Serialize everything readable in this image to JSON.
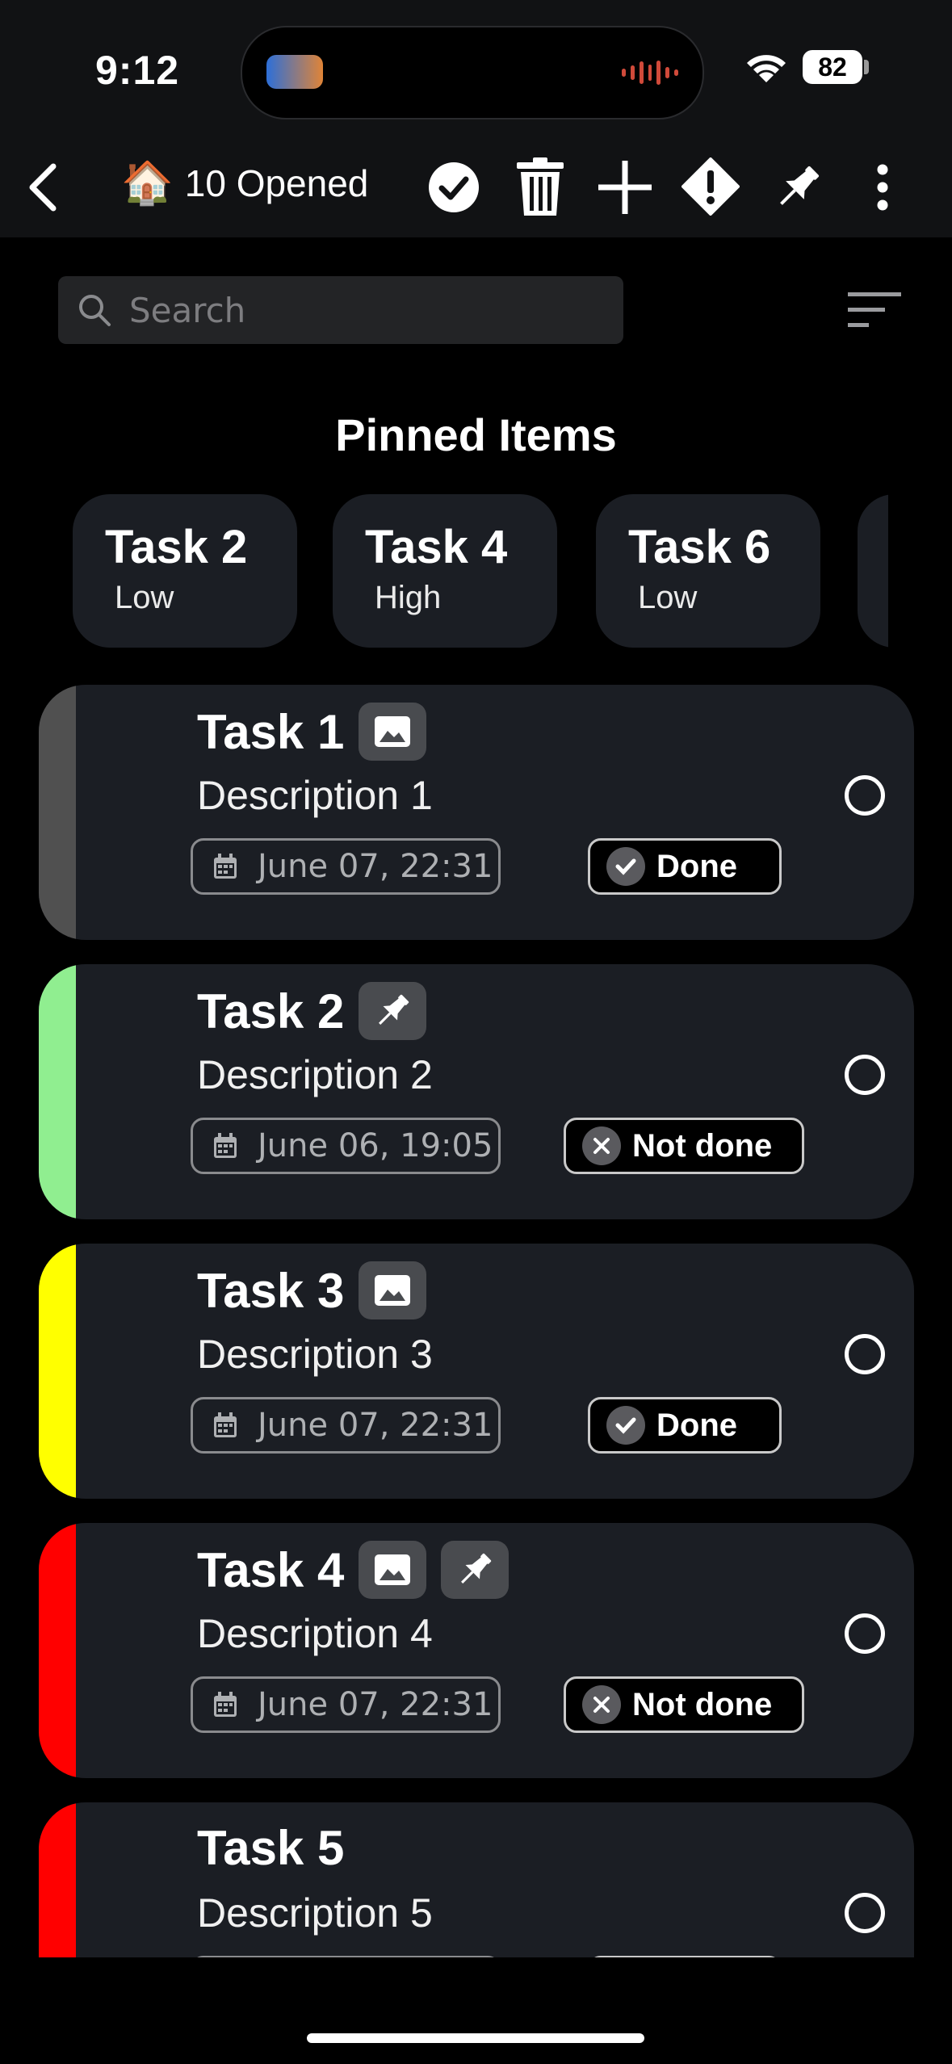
{
  "status_bar": {
    "time": "9:12",
    "battery": "82"
  },
  "app_bar": {
    "title_emoji": "🏠",
    "title": "10 Opened",
    "icons": [
      "back-arrow-icon",
      "check-circle-icon",
      "trash-icon",
      "plus-icon",
      "warning-diamond-icon",
      "pin-icon",
      "more-vertical-icon"
    ]
  },
  "search": {
    "placeholder": "Search",
    "value": ""
  },
  "pinned": {
    "title": "Pinned Items",
    "chips": [
      {
        "name": "Task 2",
        "priority": "Low"
      },
      {
        "name": "Task 4",
        "priority": "High"
      },
      {
        "name": "Task 6",
        "priority": "Low"
      }
    ]
  },
  "tasks": [
    {
      "name": "Task 1",
      "description": "Description 1",
      "date": "June 07, 22:31",
      "status": "Done",
      "color": "#505050",
      "badges": [
        "image-icon"
      ]
    },
    {
      "name": "Task 2",
      "description": "Description 2",
      "date": "June 06, 19:05",
      "status": "Not done",
      "color": "#90ee90",
      "badges": [
        "pin-icon"
      ]
    },
    {
      "name": "Task 3",
      "description": "Description 3",
      "date": "June 07, 22:31",
      "status": "Done",
      "color": "#ffff00",
      "badges": [
        "image-icon"
      ]
    },
    {
      "name": "Task 4",
      "description": "Description 4",
      "date": "June 07, 22:31",
      "status": "Not done",
      "color": "#ff0000",
      "badges": [
        "image-icon",
        "pin-icon"
      ]
    },
    {
      "name": "Task 5",
      "description": "Description 5",
      "date": "",
      "status": "",
      "color": "#ff0000",
      "badges": []
    }
  ]
}
